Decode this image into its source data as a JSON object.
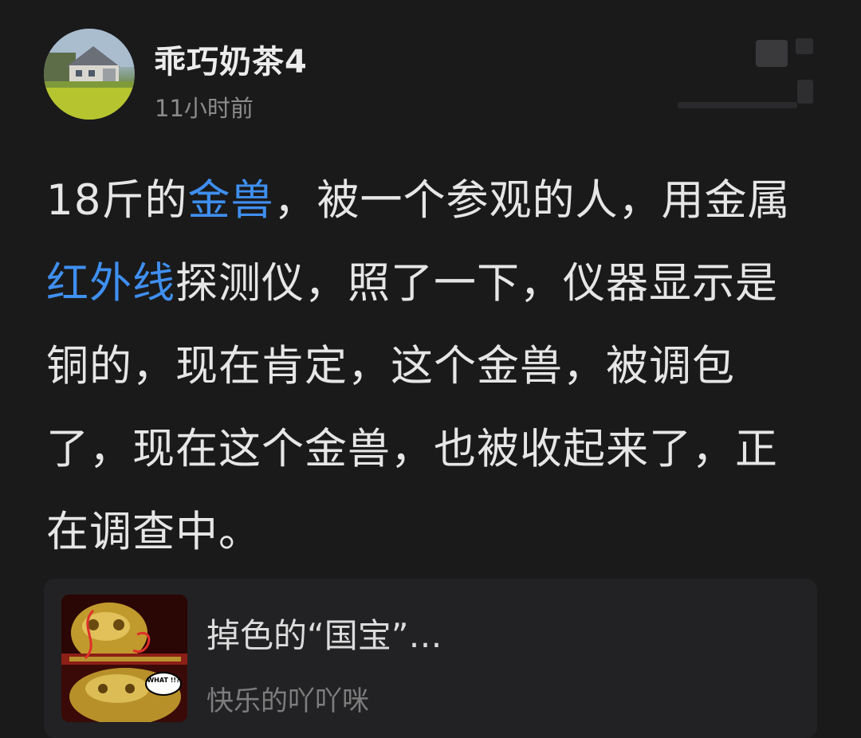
{
  "post": {
    "author": "乖巧奶茶4",
    "time": "11小时前",
    "text_segments": [
      {
        "t": "18斤的",
        "k": false
      },
      {
        "t": "金兽",
        "k": true
      },
      {
        "t": "，被一个参观的人，用金属",
        "k": false
      },
      {
        "t": "红外线",
        "k": true
      },
      {
        "t": "探测仪，照了一下，仪器显示是铜的，现在肯定，这个金兽，被调包了，现在这个金兽，也被收起来了，正在调查中。",
        "k": false
      }
    ]
  },
  "linked_post": {
    "title": "掉色的“国宝”…",
    "author": "快乐的吖吖咪",
    "thumb_sticker": "WHAT !!?"
  },
  "colors": {
    "background": "#1a1a1b",
    "keyword": "#3f8ff0",
    "text": "#e6e6e6",
    "muted": "#8c8c8c"
  },
  "icons": [
    "avatar-house-photo",
    "more-options-blurred",
    "golden-beast-thumbnail"
  ]
}
